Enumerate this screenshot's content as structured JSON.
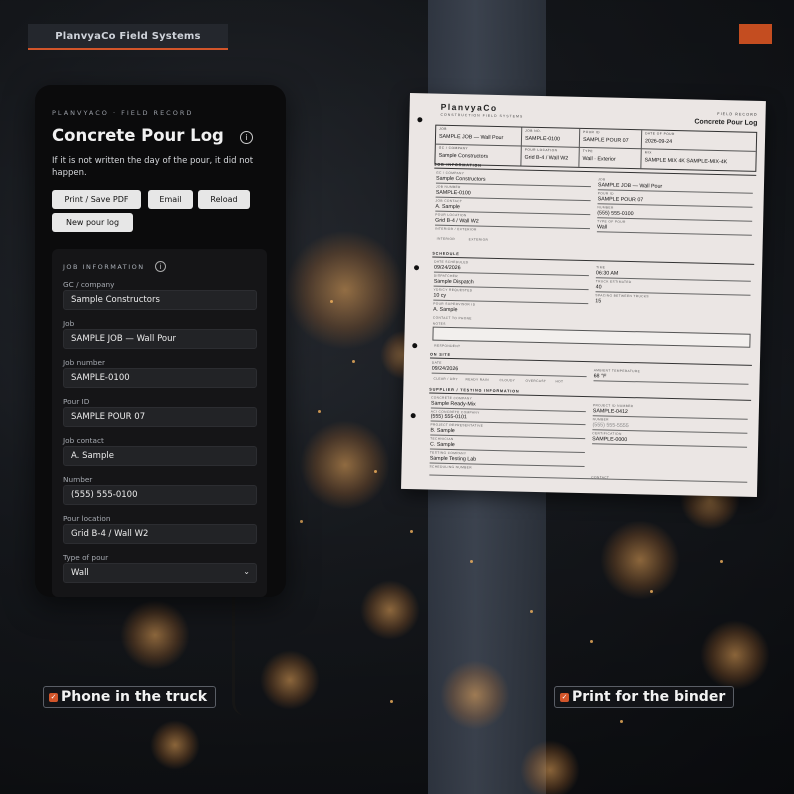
{
  "brand_tag": "PlanvyaCo Field Systems",
  "phone": {
    "eyebrow": "PLANVYACO · FIELD RECORD",
    "title": "Concrete Pour Log",
    "subtitle": "If it is not written the day of the pour, it did not happen.",
    "buttons": [
      "Print / Save PDF",
      "Email",
      "Reload",
      "New pour log"
    ],
    "section": "JOB INFORMATION",
    "fields": [
      {
        "label": "GC / company",
        "value": "Sample Constructors"
      },
      {
        "label": "Job",
        "value": "SAMPLE JOB — Wall Pour"
      },
      {
        "label": "Job number",
        "value": "SAMPLE-0100"
      },
      {
        "label": "Pour ID",
        "value": "SAMPLE POUR 07"
      },
      {
        "label": "Job contact",
        "value": "A. Sample"
      },
      {
        "label": "Number",
        "value": "(555) 555-0100"
      },
      {
        "label": "Pour location",
        "value": "Grid B-4 / Wall W2"
      },
      {
        "label": "Type of pour",
        "value": "Wall"
      }
    ]
  },
  "paper": {
    "brand": "PlanvyaCo",
    "brand_sub": "CONSTRUCTION FIELD SYSTEMS",
    "record_label": "FIELD RECORD",
    "title": "Concrete Pour Log",
    "grid": [
      {
        "label": "JOB",
        "value": "SAMPLE JOB — Wall Pour"
      },
      {
        "label": "JOB NO.",
        "value": "SAMPLE-0100"
      },
      {
        "label": "POUR ID",
        "value": "SAMPLE POUR 07"
      },
      {
        "label": "DATE OF POUR",
        "value": "2026-09-24"
      },
      {
        "label": "GC / COMPANY",
        "value": "Sample Constructors"
      },
      {
        "label": "POUR LOCATION",
        "value": "Grid B-4 / Wall W2"
      },
      {
        "label": "TYPE",
        "value": "Wall · Exterior"
      },
      {
        "label": "MIX",
        "value": "SAMPLE MIX 4K SAMPLE-MIX-4K"
      }
    ],
    "job_info": {
      "heading": "JOB INFORMATION",
      "left": [
        {
          "label": "GC / COMPANY",
          "value": "Sample Constructors"
        },
        {
          "label": "JOB NUMBER",
          "value": "SAMPLE-0100"
        },
        {
          "label": "JOB CONTACT",
          "value": "A. Sample"
        },
        {
          "label": "POUR LOCATION",
          "value": "Grid B-4 / Wall W2"
        }
      ],
      "right": [
        {
          "label": "JOB",
          "value": "SAMPLE JOB — Wall Pour"
        },
        {
          "label": "POUR ID",
          "value": "SAMPLE POUR 07"
        },
        {
          "label": "NUMBER",
          "value": "(555) 555-0100"
        },
        {
          "label": "TYPE OF POUR",
          "value": "Wall"
        }
      ],
      "checks": [
        "INTERIOR",
        "EXTERIOR"
      ],
      "check_label": "INTERIOR / EXTERIOR"
    },
    "schedule": {
      "heading": "SCHEDULE",
      "left": [
        {
          "label": "DATE SCHEDULED",
          "value": "09/24/2026"
        },
        {
          "label": "DISPATCHER",
          "value": "Sample Dispatch"
        },
        {
          "label": "YDS/CY REQUESTED",
          "value": "10 cy"
        },
        {
          "label": "POUR SUPERVISOR ID",
          "value": "A. Sample"
        }
      ],
      "right": [
        {
          "label": "TIME",
          "value": "06:30 AM"
        },
        {
          "label": "TRUCK ESTIMATED",
          "value": "40"
        },
        {
          "label": "SPACING BETWEEN TRUCKS",
          "value": "15"
        }
      ],
      "notes_label": "NOTES",
      "response_label": "RESPONDENT",
      "contact_label": "CONTACT TO PHONE"
    },
    "on_site": {
      "heading": "ON SITE",
      "date_label": "DATE",
      "date": "09/24/2026",
      "temp_label": "AMBIENT TEMPERATURE",
      "temp": "68 °F",
      "checks": [
        "CLEAR / DRY",
        "READY RAIN",
        "CLOUDY",
        "OVERCAST",
        "HOT"
      ]
    },
    "supplier": {
      "heading": "SUPPLIER / TESTING INFORMATION",
      "left": [
        {
          "label": "CONCRETE COMPANY",
          "value": "Sample Ready-Mix"
        },
        {
          "label": "NUMBER",
          "value": "(555) 555-0101"
        },
        {
          "label": "PROJECT REPRESENTATIVE",
          "value": "B. Sample"
        },
        {
          "label": "TECHNICIAN",
          "value": "C. Sample"
        },
        {
          "label": "TESTING COMPANY",
          "value": "Sample Testing Lab"
        }
      ],
      "right": [
        {
          "label": "PROJECT ID NUMBER",
          "value": "SAMPLE-0412"
        },
        {
          "label": "NUMBER",
          "value": "(555) 555-5555"
        },
        {
          "label": "CERTIFICATION",
          "value": "SAMPLE-0000"
        }
      ],
      "extra_labels": [
        "ACI CONCRETE COMPANY",
        "SCHEDULING NUMBER",
        "CONTACT"
      ]
    }
  },
  "captions": {
    "left": "Phone in the truck",
    "right": "Print for the binder",
    "check_glyph": "✓"
  },
  "colors": {
    "accent": "#d2552a",
    "phone_bg": "#0b0b0c",
    "paper_bg": "#ebe6e4"
  }
}
